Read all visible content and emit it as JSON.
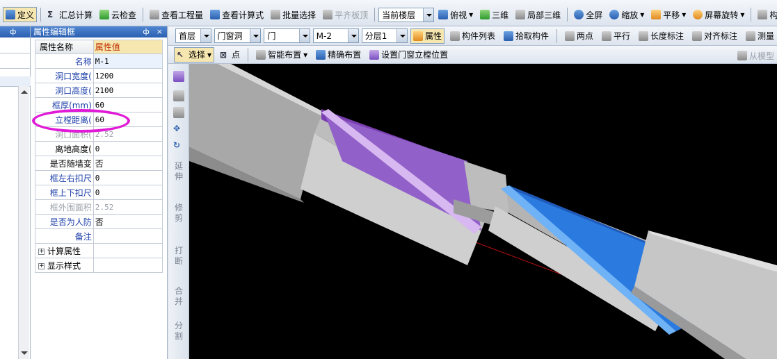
{
  "main_toolbar": {
    "define": "定义",
    "sum_calc": "汇总计算",
    "cloud_check": "云检查",
    "view_quantity": "查看工程量",
    "view_formula": "查看计算式",
    "batch_select": "批量选择",
    "level_slab": "平齐板顶",
    "current_floor": "当前楼层",
    "top_view": "俯视",
    "three_d": "三维",
    "partial_3d": "局部三维",
    "fullscreen": "全屏",
    "zoom": "缩放",
    "pan": "平移",
    "rotate": "屏幕旋转",
    "component": "构件"
  },
  "left_panel": {
    "pin": "ф"
  },
  "property_panel": {
    "title": "属性编辑框",
    "pin": "ф",
    "close": "×",
    "col_name": "属性名称",
    "col_value": "属性值",
    "rows": [
      {
        "name": "名称",
        "value": "M-1"
      },
      {
        "name": "洞口宽度(",
        "value": "1200"
      },
      {
        "name": "洞口高度(",
        "value": "2100"
      },
      {
        "name": "框厚(mm)",
        "value": "60"
      },
      {
        "name": "立樘距离(",
        "value": "60"
      },
      {
        "name": "洞口面积(",
        "value": "2.52"
      },
      {
        "name": "离地高度(",
        "value": "0"
      },
      {
        "name": "是否随墙变",
        "value": "否"
      },
      {
        "name": "框左右扣尺",
        "value": "0"
      },
      {
        "name": "框上下扣尺",
        "value": "0"
      },
      {
        "name": "框外围面积",
        "value": "2.52"
      },
      {
        "name": "是否为人防",
        "value": "否"
      },
      {
        "name": "备注",
        "value": ""
      }
    ],
    "groups": [
      {
        "label": "计算属性"
      },
      {
        "label": "显示样式"
      }
    ]
  },
  "filter_toolbar": {
    "floor": "首层",
    "category": "门窗洞",
    "type": "门",
    "component": "M-2",
    "layer": "分层1",
    "properties": "属性",
    "component_list": "构件列表",
    "pick": "拾取构件",
    "two_points": "两点",
    "parallel": "平行",
    "length_dim": "长度标注",
    "align_dim": "对齐标注",
    "measure": "测量"
  },
  "draw_toolbar": {
    "select": "选择",
    "point": "点",
    "smart_layout": "智能布置",
    "precise_layout": "精确布置",
    "set_frame_pos": "设置门窗立樘位置",
    "from_model": "从模型"
  },
  "side_tools": {
    "extend": "延伸",
    "trim": "修剪",
    "break": "打断",
    "merge": "合并",
    "split": "分割"
  },
  "colors": {
    "panel_title": "#2b5fb0",
    "value_header": "#f6e6b0",
    "highlight": "#e01ad6",
    "wall": "#c8c8c8",
    "door_purple": "#8a55c8",
    "door_blue": "#3a8ee8"
  }
}
